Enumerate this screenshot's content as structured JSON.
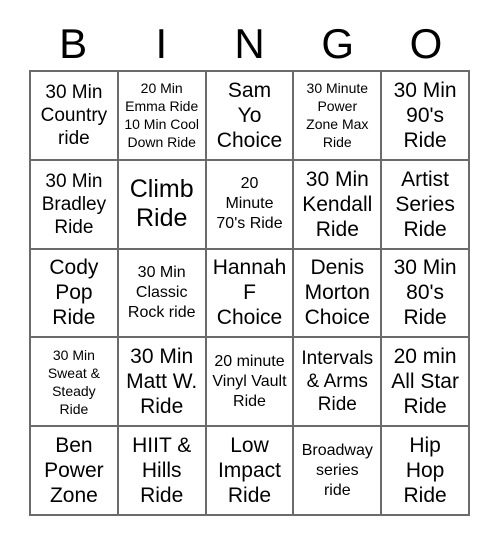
{
  "card": {
    "title": "BINGO",
    "header_letters": [
      "B",
      "I",
      "N",
      "G",
      "O"
    ],
    "grid_size": "5x5",
    "colors": {
      "text": "#000000",
      "background": "#ffffff",
      "grid_line": "#6b6b6b"
    }
  },
  "cells": [
    {
      "id": "b1",
      "column": "B",
      "row": 1,
      "text": "30 Min\nCountry\nride",
      "size": "md"
    },
    {
      "id": "i1",
      "column": "I",
      "row": 1,
      "text": "20 Min\nEmma Ride\n10 Min Cool\nDown Ride",
      "size": "xs"
    },
    {
      "id": "n1",
      "column": "N",
      "row": 1,
      "text": "Sam\nYo\nChoice",
      "size": "lg"
    },
    {
      "id": "g1",
      "column": "G",
      "row": 1,
      "text": "30 Minute\nPower\nZone Max\nRide",
      "size": "xs"
    },
    {
      "id": "o1",
      "column": "O",
      "row": 1,
      "text": "30 Min\n90's\nRide",
      "size": "lg"
    },
    {
      "id": "b2",
      "column": "B",
      "row": 2,
      "text": "30 Min\nBradley\nRide",
      "size": "md"
    },
    {
      "id": "i2",
      "column": "I",
      "row": 2,
      "text": "Climb\nRide",
      "size": "xl"
    },
    {
      "id": "n2",
      "column": "N",
      "row": 2,
      "text": "20\nMinute\n70's Ride",
      "size": "sm"
    },
    {
      "id": "g2",
      "column": "G",
      "row": 2,
      "text": "30 Min\nKendall\nRide",
      "size": "lg"
    },
    {
      "id": "o2",
      "column": "O",
      "row": 2,
      "text": "Artist\nSeries\nRide",
      "size": "lg"
    },
    {
      "id": "b3",
      "column": "B",
      "row": 3,
      "text": "Cody\nPop\nRide",
      "size": "lg"
    },
    {
      "id": "i3",
      "column": "I",
      "row": 3,
      "text": "30 Min\nClassic\nRock ride",
      "size": "sm"
    },
    {
      "id": "n3",
      "column": "N",
      "row": 3,
      "text": "Hannah\nF\nChoice",
      "size": "lg"
    },
    {
      "id": "g3",
      "column": "G",
      "row": 3,
      "text": "Denis\nMorton\nChoice",
      "size": "lg"
    },
    {
      "id": "o3",
      "column": "O",
      "row": 3,
      "text": "30 Min\n80's\nRide",
      "size": "lg"
    },
    {
      "id": "b4",
      "column": "B",
      "row": 4,
      "text": "30 Min\nSweat &\nSteady\nRide",
      "size": "xs"
    },
    {
      "id": "i4",
      "column": "I",
      "row": 4,
      "text": "30 Min\nMatt W.\nRide",
      "size": "lg"
    },
    {
      "id": "n4",
      "column": "N",
      "row": 4,
      "text": "20 minute\nVinyl Vault\nRide",
      "size": "sm"
    },
    {
      "id": "g4",
      "column": "G",
      "row": 4,
      "text": "Intervals\n& Arms\nRide",
      "size": "md"
    },
    {
      "id": "o4",
      "column": "O",
      "row": 4,
      "text": "20 min\nAll Star\nRide",
      "size": "lg"
    },
    {
      "id": "b5",
      "column": "B",
      "row": 5,
      "text": "Ben\nPower\nZone",
      "size": "lg"
    },
    {
      "id": "i5",
      "column": "I",
      "row": 5,
      "text": "HIIT &\nHills\nRide",
      "size": "lg"
    },
    {
      "id": "n5",
      "column": "N",
      "row": 5,
      "text": "Low\nImpact\nRide",
      "size": "lg"
    },
    {
      "id": "g5",
      "column": "G",
      "row": 5,
      "text": "Broadway\nseries\nride",
      "size": "sm"
    },
    {
      "id": "o5",
      "column": "O",
      "row": 5,
      "text": "Hip\nHop\nRide",
      "size": "lg"
    }
  ]
}
